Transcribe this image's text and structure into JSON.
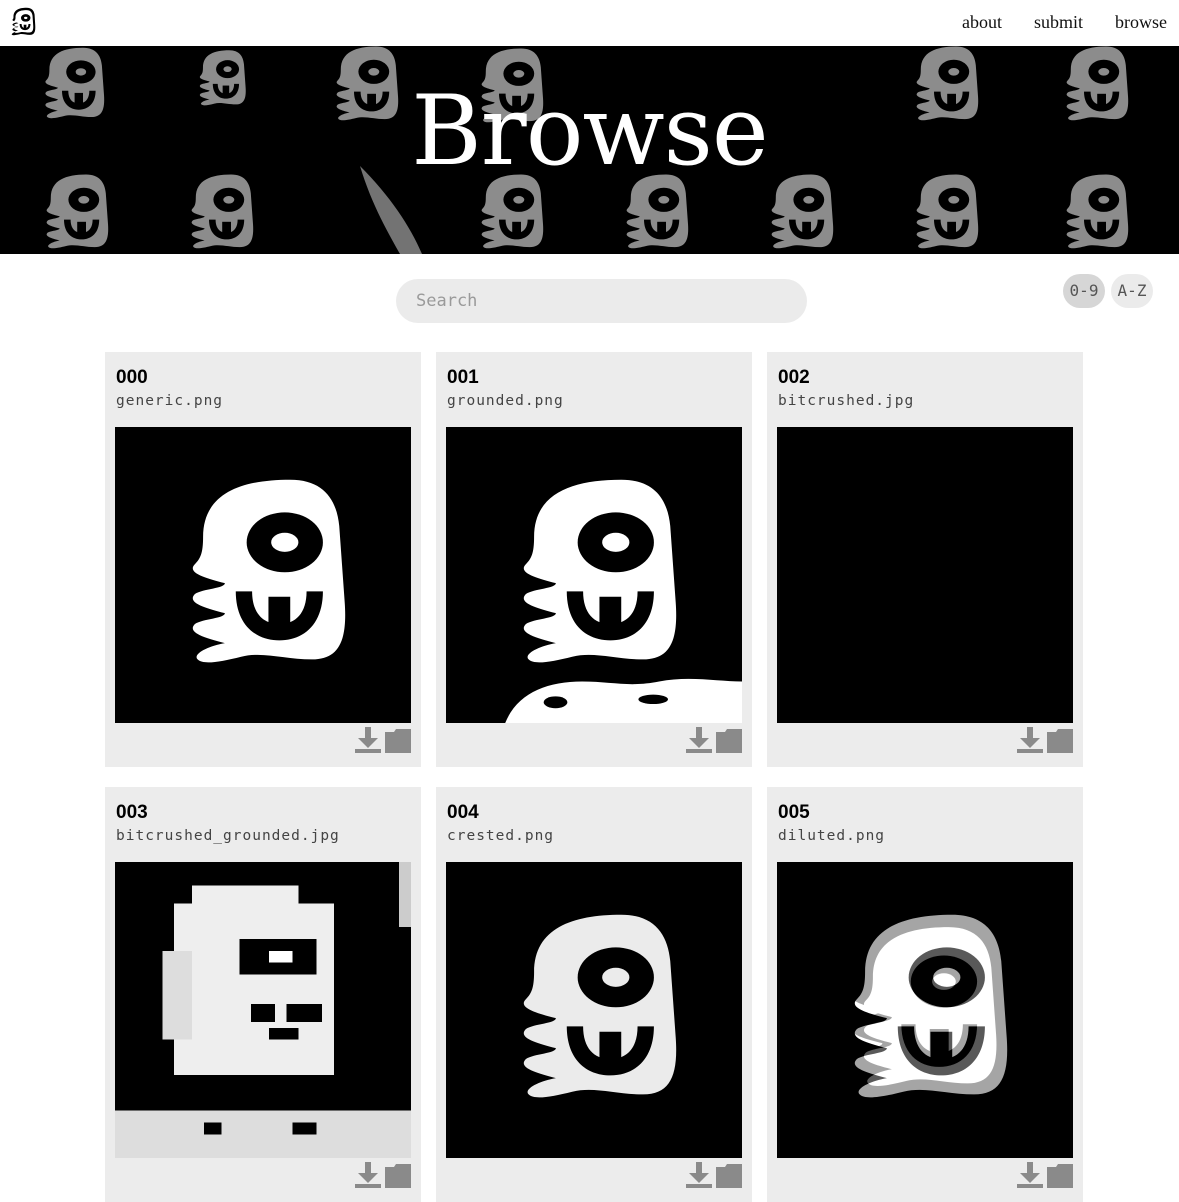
{
  "nav": {
    "links": [
      "about",
      "submit",
      "browse"
    ]
  },
  "hero": {
    "title": "Browse"
  },
  "search": {
    "placeholder": "Search"
  },
  "sort": {
    "numeric_label": "0-9",
    "alpha_label": "A-Z",
    "active": "0-9"
  },
  "items": [
    {
      "num": "000",
      "filename": "generic.png",
      "style": "generic"
    },
    {
      "num": "001",
      "filename": "grounded.png",
      "style": "grounded"
    },
    {
      "num": "002",
      "filename": "bitcrushed.jpg",
      "style": "bitcrushed"
    },
    {
      "num": "003",
      "filename": "bitcrushed_grounded.jpg",
      "style": "bitcrushed-grounded"
    },
    {
      "num": "004",
      "filename": "crested.png",
      "style": "crested"
    },
    {
      "num": "005",
      "filename": "diluted.png",
      "style": "diluted"
    }
  ],
  "colors": {
    "card_bg": "#ececec",
    "hero_bg": "#000000",
    "icon_grey": "#8a8a8a",
    "search_bg": "#ebebeb"
  }
}
